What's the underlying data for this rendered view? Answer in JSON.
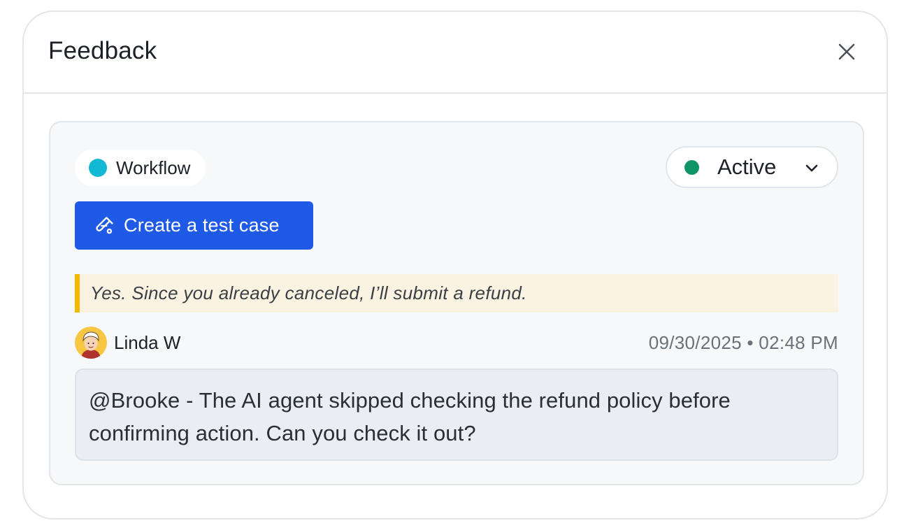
{
  "modal": {
    "title": "Feedback",
    "close_icon": "close-icon"
  },
  "card": {
    "tag": {
      "label": "Workflow",
      "color": "#13b8d4"
    },
    "status": {
      "label": "Active",
      "color": "#0f9467",
      "icon": "chevron-down-icon"
    },
    "create_button": {
      "label": "Create a test case",
      "icon": "test-tube-icon",
      "color": "#1f5ae6"
    },
    "quote": {
      "text": "Yes. Since you already canceled, I’ll submit a refund.",
      "accent_color": "#f5b800"
    },
    "comment": {
      "author": "Linda W",
      "timestamp": "09/30/2025 • 02:48 PM",
      "text": "@Brooke - The AI agent skipped checking the refund policy before confirming action. Can you check it out?"
    }
  }
}
